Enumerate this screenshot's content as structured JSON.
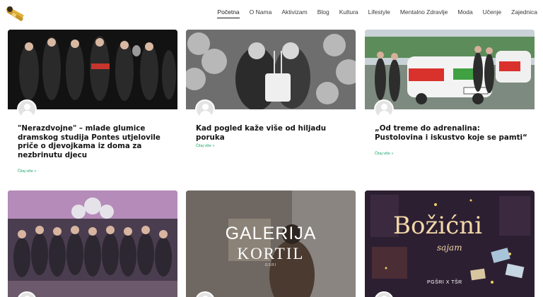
{
  "nav": {
    "items": [
      "Početna",
      "O Nama",
      "Aktivizam",
      "Blog",
      "Kultura",
      "Lifestyle",
      "Mentalno Zdravlje",
      "Moda",
      "Učenje",
      "Zajednica"
    ],
    "active_index": 0
  },
  "posts": [
    {
      "title": "\"Nerazdvojne\" – mlade glumice dramskog studija Pontes utjelovile priče o djevojkama iz doma za nezbrinutu djecu",
      "read_more": "Čitaj više »"
    },
    {
      "title": "Kad pogled kaže više od hiljadu poruka",
      "read_more": "Čitaj više »"
    },
    {
      "title": "„Od treme do adrenalina: Pustolovina i iskustvo koje se pamti“",
      "read_more": "Čitaj više »"
    }
  ],
  "image_texts": {
    "galerija_line1": "GALERIJA",
    "galerija_line2": "KORTIL",
    "galerija_sub": "GSRI",
    "bozicni_line1": "Božićni",
    "bozicni_line2": "sajam",
    "bozicni_sub": "PGŠRI X TŠR"
  },
  "colors": {
    "accent": "#19a56a",
    "text": "#151515"
  }
}
